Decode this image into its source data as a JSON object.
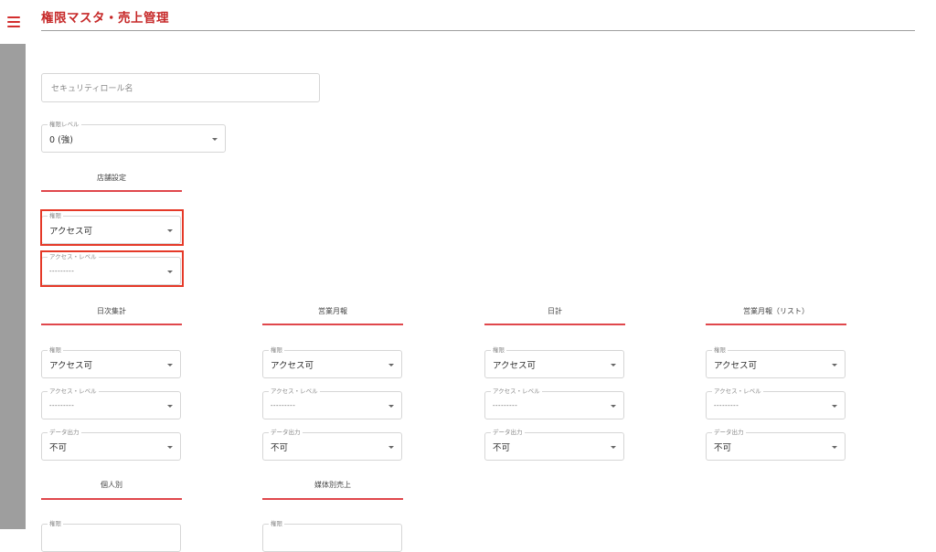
{
  "page": {
    "title": "権限マスタ・売上管理"
  },
  "role_name": {
    "placeholder": "セキュリティロール名"
  },
  "permission_level": {
    "label": "権限レベル",
    "value": "0 (強)"
  },
  "store_settings": {
    "title": "店舗設定",
    "permission": {
      "label": "権限",
      "value": "アクセス可"
    },
    "access_level": {
      "label": "アクセス・レベル",
      "value": "---------"
    }
  },
  "sections": [
    {
      "title": "日次集計",
      "permission": {
        "label": "権限",
        "value": "アクセス可"
      },
      "access_level": {
        "label": "アクセス・レベル",
        "value": "---------"
      },
      "data_output": {
        "label": "データ出力",
        "value": "不可"
      }
    },
    {
      "title": "営業月報",
      "permission": {
        "label": "権限",
        "value": "アクセス可"
      },
      "access_level": {
        "label": "アクセス・レベル",
        "value": "---------"
      },
      "data_output": {
        "label": "データ出力",
        "value": "不可"
      }
    },
    {
      "title": "日計",
      "permission": {
        "label": "権限",
        "value": "アクセス可"
      },
      "access_level": {
        "label": "アクセス・レベル",
        "value": "---------"
      },
      "data_output": {
        "label": "データ出力",
        "value": "不可"
      }
    },
    {
      "title": "営業月報（リスト）",
      "permission": {
        "label": "権限",
        "value": "アクセス可"
      },
      "access_level": {
        "label": "アクセス・レベル",
        "value": "---------"
      },
      "data_output": {
        "label": "データ出力",
        "value": "不可"
      }
    }
  ],
  "lower_sections": [
    {
      "title": "個人別",
      "permission": {
        "label": "権限"
      }
    },
    {
      "title": "媒体別売上",
      "permission": {
        "label": "権限"
      }
    }
  ],
  "colors": {
    "accent": "#c62828",
    "rule": "#e0474c",
    "highlight": "#e53928",
    "sidebar": "#9e9e9e"
  },
  "icons": {
    "menu": "hamburger-menu-icon",
    "dropdown": "chevron-down-icon"
  }
}
